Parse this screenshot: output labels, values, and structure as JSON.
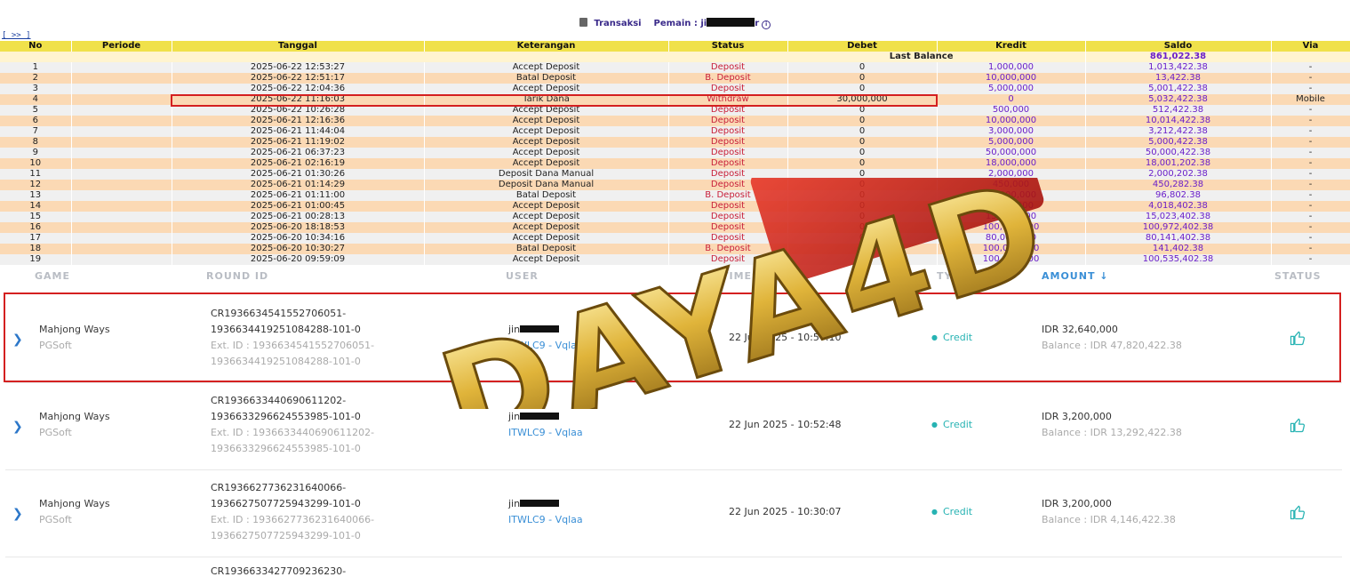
{
  "header": {
    "transaksi_label": "Transaksi",
    "pemain_label": "Pemain : ji",
    "pemain_suffix": "r"
  },
  "nav_link": "[ >> ]",
  "table": {
    "columns": [
      "No",
      "Periode",
      "Tanggal",
      "Keterangan",
      "Status",
      "Debet",
      "Kredit",
      "Saldo",
      "Via"
    ],
    "last_balance_label": "Last Balance",
    "last_balance_value": "861,022.38",
    "rows": [
      {
        "no": "1",
        "periode": "",
        "tanggal": "2025-06-22 12:53:27",
        "ket": "Accept Deposit",
        "status": "Deposit",
        "debet": "0",
        "kredit": "1,000,000",
        "saldo": "1,013,422.38",
        "via": "-"
      },
      {
        "no": "2",
        "periode": "",
        "tanggal": "2025-06-22 12:51:17",
        "ket": "Batal Deposit",
        "status": "B. Deposit",
        "debet": "0",
        "kredit": "10,000,000",
        "saldo": "13,422.38",
        "via": "-"
      },
      {
        "no": "3",
        "periode": "",
        "tanggal": "2025-06-22 12:04:36",
        "ket": "Accept Deposit",
        "status": "Deposit",
        "debet": "0",
        "kredit": "5,000,000",
        "saldo": "5,001,422.38",
        "via": "-"
      },
      {
        "no": "4",
        "periode": "",
        "tanggal": "2025-06-22 11:16:03",
        "ket": "Tarik Dana",
        "status": "Withdraw",
        "debet": "30,000,000",
        "kredit": "0",
        "saldo": "5,032,422.38",
        "via": "Mobile"
      },
      {
        "no": "5",
        "periode": "",
        "tanggal": "2025-06-22 10:26:28",
        "ket": "Accept Deposit",
        "status": "Deposit",
        "debet": "0",
        "kredit": "500,000",
        "saldo": "512,422.38",
        "via": "-"
      },
      {
        "no": "6",
        "periode": "",
        "tanggal": "2025-06-21 12:16:36",
        "ket": "Accept Deposit",
        "status": "Deposit",
        "debet": "0",
        "kredit": "10,000,000",
        "saldo": "10,014,422.38",
        "via": "-"
      },
      {
        "no": "7",
        "periode": "",
        "tanggal": "2025-06-21 11:44:04",
        "ket": "Accept Deposit",
        "status": "Deposit",
        "debet": "0",
        "kredit": "3,000,000",
        "saldo": "3,212,422.38",
        "via": "-"
      },
      {
        "no": "8",
        "periode": "",
        "tanggal": "2025-06-21 11:19:02",
        "ket": "Accept Deposit",
        "status": "Deposit",
        "debet": "0",
        "kredit": "5,000,000",
        "saldo": "5,000,422.38",
        "via": "-"
      },
      {
        "no": "9",
        "periode": "",
        "tanggal": "2025-06-21 06:37:23",
        "ket": "Accept Deposit",
        "status": "Deposit",
        "debet": "0",
        "kredit": "50,000,000",
        "saldo": "50,000,422.38",
        "via": "-"
      },
      {
        "no": "10",
        "periode": "",
        "tanggal": "2025-06-21 02:16:19",
        "ket": "Accept Deposit",
        "status": "Deposit",
        "debet": "0",
        "kredit": "18,000,000",
        "saldo": "18,001,202.38",
        "via": "-"
      },
      {
        "no": "11",
        "periode": "",
        "tanggal": "2025-06-21 01:30:26",
        "ket": "Deposit Dana Manual",
        "status": "Deposit",
        "debet": "0",
        "kredit": "2,000,000",
        "saldo": "2,000,202.38",
        "via": "-"
      },
      {
        "no": "12",
        "periode": "",
        "tanggal": "2025-06-21 01:14:29",
        "ket": "Deposit Dana Manual",
        "status": "Deposit",
        "debet": "0",
        "kredit": "450,000",
        "saldo": "450,282.38",
        "via": "-"
      },
      {
        "no": "13",
        "periode": "",
        "tanggal": "2025-06-21 01:11:00",
        "ket": "Batal Deposit",
        "status": "B. Deposit",
        "debet": "0",
        "kredit": "20,000,000",
        "saldo": "96,802.38",
        "via": "-"
      },
      {
        "no": "14",
        "periode": "",
        "tanggal": "2025-06-21 01:00:45",
        "ket": "Accept Deposit",
        "status": "Deposit",
        "debet": "0",
        "kredit": "4,000,000",
        "saldo": "4,018,402.38",
        "via": "-"
      },
      {
        "no": "15",
        "periode": "",
        "tanggal": "2025-06-21 00:28:13",
        "ket": "Accept Deposit",
        "status": "Deposit",
        "debet": "0",
        "kredit": "15,000,000",
        "saldo": "15,023,402.38",
        "via": "-"
      },
      {
        "no": "16",
        "periode": "",
        "tanggal": "2025-06-20 18:18:53",
        "ket": "Accept Deposit",
        "status": "Deposit",
        "debet": "0",
        "kredit": "100,000,000",
        "saldo": "100,972,402.38",
        "via": "-"
      },
      {
        "no": "17",
        "periode": "",
        "tanggal": "2025-06-20 10:34:16",
        "ket": "Accept Deposit",
        "status": "Deposit",
        "debet": "0",
        "kredit": "80,000,000",
        "saldo": "80,141,402.38",
        "via": "-"
      },
      {
        "no": "18",
        "periode": "",
        "tanggal": "2025-06-20 10:30:27",
        "ket": "Batal Deposit",
        "status": "B. Deposit",
        "debet": "0",
        "kredit": "100,000,000",
        "saldo": "141,402.38",
        "via": "-"
      },
      {
        "no": "19",
        "periode": "",
        "tanggal": "2025-06-20 09:59:09",
        "ket": "Accept Deposit",
        "status": "Deposit",
        "debet": "0",
        "kredit": "100,000,000",
        "saldo": "100,535,402.38",
        "via": "-"
      }
    ]
  },
  "game_columns": {
    "game": "GAME",
    "round_id": "ROUND ID",
    "user": "USER",
    "timestamp": "TIMESTAMP",
    "type": "TYPE",
    "amount": "AMOUNT",
    "amount_sort_icon": "arrow-down-icon",
    "status": "STATUS"
  },
  "game_rows": [
    {
      "game": "Mahjong Ways",
      "provider": "PGSoft",
      "round_id_1": "CR1936634541552706051-",
      "round_id_2": "1936634419251084288-101-0",
      "ext_1": "Ext. ID : 1936634541552706051-",
      "ext_2": "1936634419251084288-101-0",
      "user": "jin",
      "agent": "ITWLC9 - Vqlaa",
      "timestamp": "22 Jun 2025 - 10:57:10",
      "type": "Credit",
      "amount": "IDR 32,640,000",
      "balance": "Balance : IDR 47,820,422.38"
    },
    {
      "game": "Mahjong Ways",
      "provider": "PGSoft",
      "round_id_1": "CR1936633440690611202-",
      "round_id_2": "1936633296624553985-101-0",
      "ext_1": "Ext. ID : 1936633440690611202-",
      "ext_2": "1936633296624553985-101-0",
      "user": "jin",
      "agent": "ITWLC9 - Vqlaa",
      "timestamp": "22 Jun 2025 - 10:52:48",
      "type": "Credit",
      "amount": "IDR 3,200,000",
      "balance": "Balance : IDR 13,292,422.38"
    },
    {
      "game": "Mahjong Ways",
      "provider": "PGSoft",
      "round_id_1": "CR1936627736231640066-",
      "round_id_2": "1936627507725943299-101-0",
      "ext_1": "Ext. ID : 1936627736231640066-",
      "ext_2": "1936627507725943299-101-0",
      "user": "jin",
      "agent": "ITWLC9 - Vqlaa",
      "timestamp": "22 Jun 2025 - 10:30:07",
      "type": "Credit",
      "amount": "IDR 3,200,000",
      "balance": "Balance : IDR 4,146,422.38"
    }
  ],
  "partial_row_round_id": "CR1936633427709236230-",
  "watermark_text": "DAYA4D",
  "colors": {
    "header_yellow": "#f0e14a",
    "row_orange": "#fbd9b4",
    "row_gray": "#f0f0f0",
    "status_red": "#c8203a",
    "amount_purple": "#6a1fc9",
    "highlight_red": "#d42020",
    "credit_teal": "#27b3b3",
    "link_blue": "#3a8fd6"
  }
}
